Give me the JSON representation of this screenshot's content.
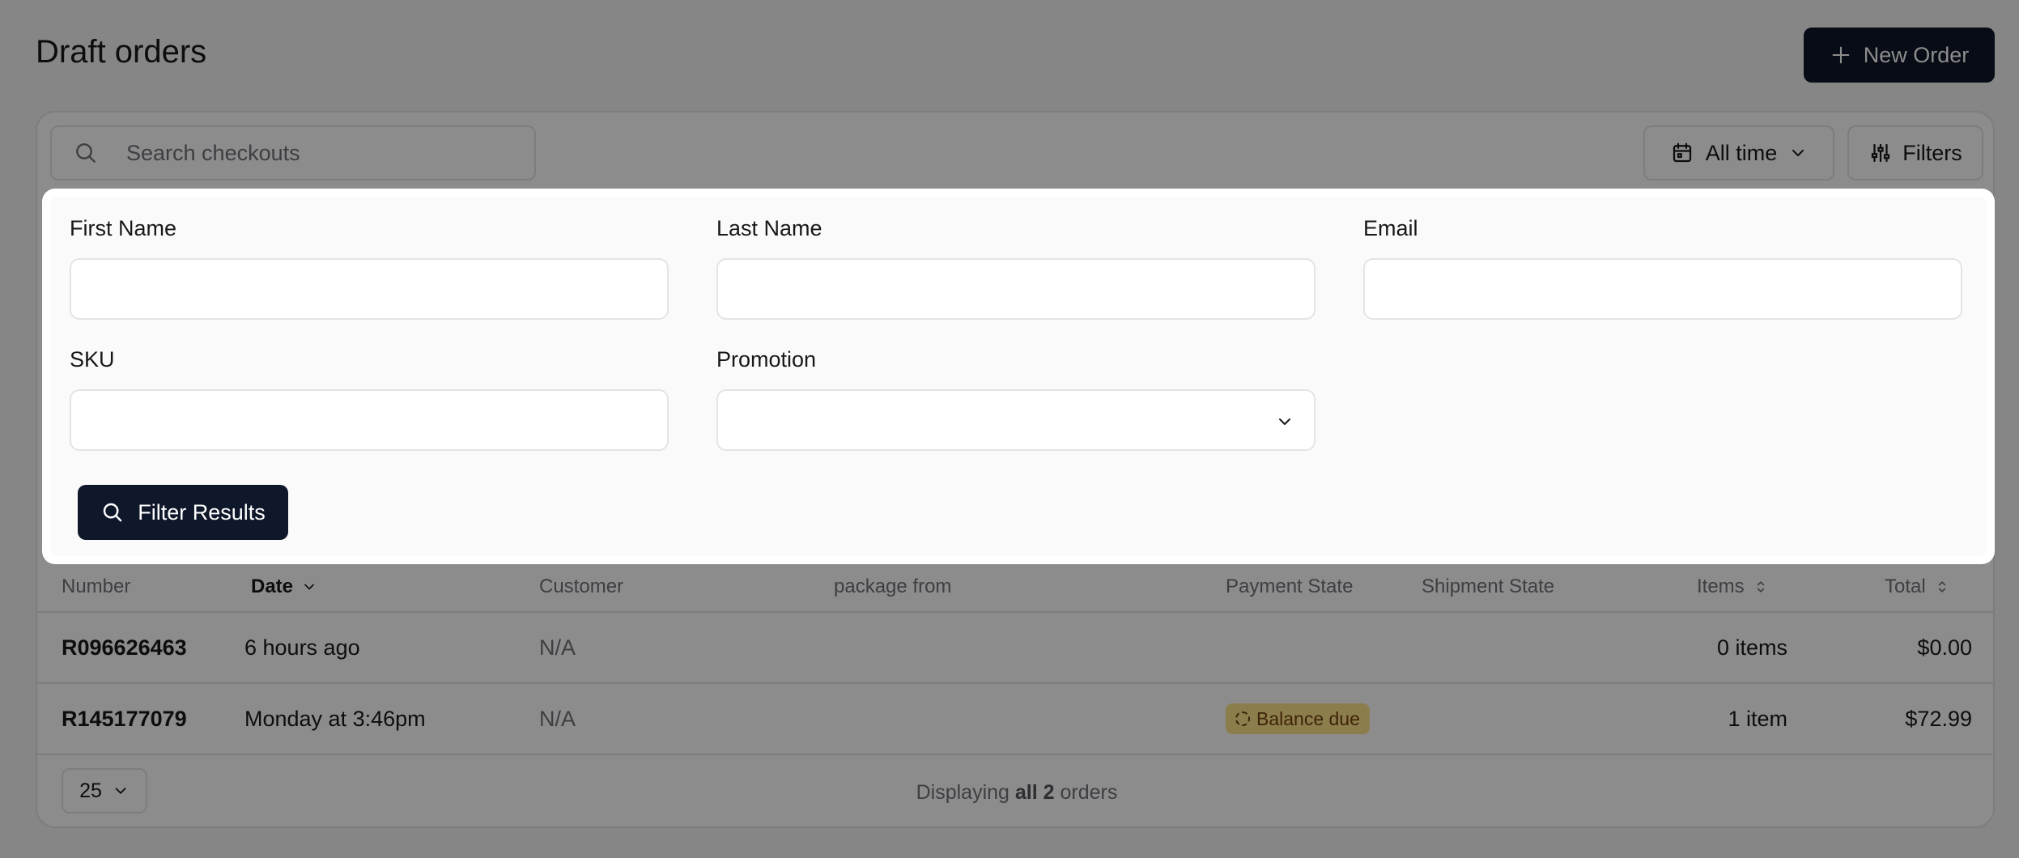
{
  "header": {
    "title": "Draft orders",
    "new_order_label": "New Order"
  },
  "toolbar": {
    "search_placeholder": "Search checkouts",
    "date_range_label": "All time",
    "filters_label": "Filters"
  },
  "filter_panel": {
    "first_name_label": "First Name",
    "last_name_label": "Last Name",
    "email_label": "Email",
    "sku_label": "SKU",
    "promotion_label": "Promotion",
    "first_name_value": "",
    "last_name_value": "",
    "email_value": "",
    "sku_value": "",
    "promotion_value": "",
    "submit_label": "Filter Results"
  },
  "table": {
    "columns": {
      "number": "Number",
      "date": "Date",
      "customer": "Customer",
      "package_from": "package from",
      "payment_state": "Payment State",
      "shipment_state": "Shipment State",
      "items": "Items",
      "total": "Total"
    },
    "rows": [
      {
        "number": "R096626463",
        "date": "6 hours ago",
        "customer": "N/A",
        "payment_state": "",
        "items": "0 items",
        "total": "$0.00"
      },
      {
        "number": "R145177079",
        "date": "Monday at 3:46pm",
        "customer": "N/A",
        "payment_state": "Balance due",
        "items": "1 item",
        "total": "$72.99"
      }
    ]
  },
  "footer": {
    "per_page": "25",
    "displaying_prefix": "Displaying",
    "displaying_bold": "all 2",
    "displaying_suffix": "orders"
  },
  "colors": {
    "primary": "#0f172a",
    "badge_warning_bg": "#fde68a",
    "overlay": "rgba(0,0,0,0.45)"
  }
}
